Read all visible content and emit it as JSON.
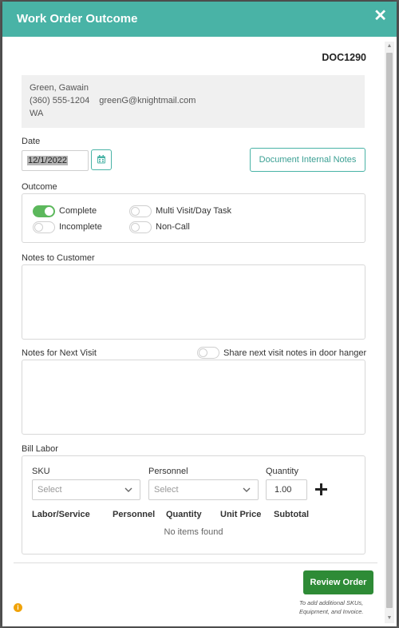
{
  "header": {
    "title": "Work Order Outcome",
    "close_icon": "close-icon"
  },
  "doc_number": "DOC1290",
  "customer": {
    "name": "Green, Gawain",
    "phone": "(360) 555-1204",
    "email": "greenG@knightmail.com",
    "state": "WA"
  },
  "date": {
    "label": "Date",
    "value": "12/1/2022"
  },
  "document_notes_button": "Document Internal Notes",
  "outcome": {
    "label": "Outcome",
    "options": [
      {
        "label": "Complete",
        "checked": true
      },
      {
        "label": "Incomplete",
        "checked": false
      },
      {
        "label": "Multi Visit/Day Task",
        "checked": false
      },
      {
        "label": "Non-Call",
        "checked": false
      }
    ]
  },
  "notes_customer": {
    "label": "Notes to Customer",
    "value": ""
  },
  "notes_next_visit": {
    "label": "Notes for Next Visit",
    "value": "",
    "share_label": "Share next visit notes in door hanger",
    "share_checked": false
  },
  "bill_labor": {
    "label": "Bill Labor",
    "sku_label": "SKU",
    "sku_placeholder": "Select",
    "personnel_label": "Personnel",
    "personnel_placeholder": "Select",
    "quantity_label": "Quantity",
    "quantity_value": "1.00",
    "add_icon": "plus-icon",
    "columns": [
      "Labor/Service",
      "Personnel",
      "Quantity",
      "Unit Price",
      "Subtotal"
    ],
    "empty_text": "No items found"
  },
  "review_button": "Review Order",
  "review_hint": "To add additional SKUs, Equipment, and Invoice.",
  "info_icon": "info-icon",
  "colors": {
    "header": "#49b3a6",
    "accent": "#3a9f93",
    "toggle_on": "#5cb85c",
    "primary_button": "#2e8b36"
  }
}
